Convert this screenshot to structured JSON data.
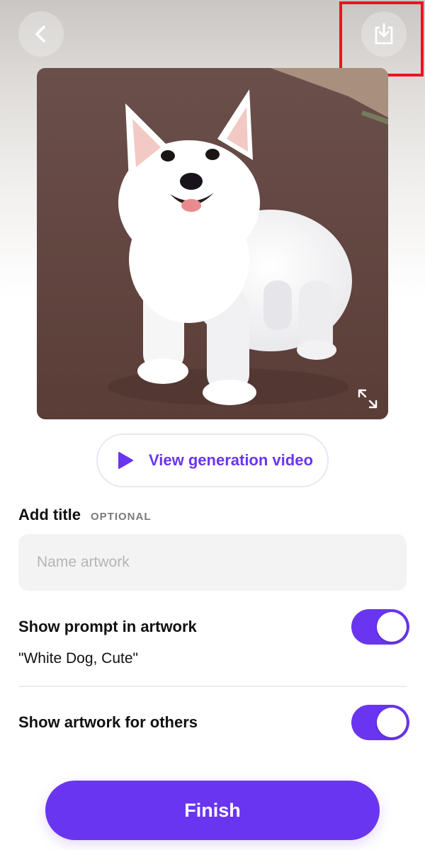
{
  "header": {
    "back_icon": "chevron-left-icon",
    "download_icon": "download-icon"
  },
  "artwork": {
    "subject": "white puppy",
    "expand_icon": "expand-icon"
  },
  "video_button": {
    "label": "View generation video",
    "icon": "play-icon"
  },
  "title_section": {
    "label": "Add title",
    "optional": "OPTIONAL",
    "placeholder": "Name artwork",
    "value": ""
  },
  "prompt_toggle": {
    "label": "Show prompt in artwork",
    "prompt": "\"White Dog, Cute\"",
    "on": true
  },
  "public_toggle": {
    "label": "Show artwork for others",
    "on": true
  },
  "finish": {
    "label": "Finish"
  },
  "colors": {
    "accent": "#6a35f0",
    "highlight": "#e8151f",
    "input_bg": "#f3f3f3"
  }
}
